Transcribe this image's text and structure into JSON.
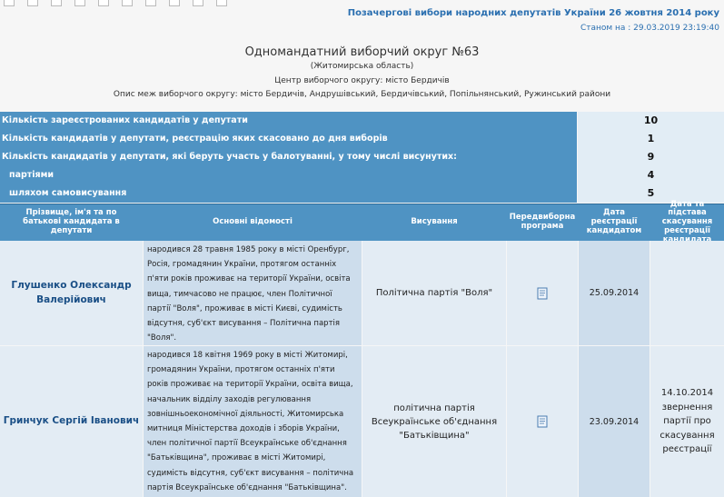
{
  "header": {
    "election_title": "Позачергові вибори народних депутатів України 26 жовтня 2014 року",
    "status": "Станом на : 29.03.2019 23:19:40"
  },
  "district": {
    "title": "Одномандатний виборчий округ №63",
    "region": "(Житомирська область)",
    "center": "Центр виборчого округу: місто Бердичів",
    "borders": "Опис меж виборчого округу: місто Бердичів, Андрушівський, Бердичівський, Попільнянський, Ружинський райони"
  },
  "stats": [
    {
      "label": "Кількість зареєстрованих кандидатів у депутати",
      "value": "10"
    },
    {
      "label": "Кількість кандидатів у депутати, реєстрацію яких скасовано до дня виборів",
      "value": "1"
    },
    {
      "label": "Кількість кандидатів у депутати, які беруть участь у балотуванні, у тому числі висунутих:",
      "value": "9"
    },
    {
      "label": "партіями",
      "value": "4"
    },
    {
      "label": "шляхом самовисування",
      "value": "5"
    }
  ],
  "table": {
    "headers": {
      "name": "Прізвище, ім'я та по батькові кандидата в депутати",
      "info": "Основні відомості",
      "nomination": "Висування",
      "program": "Передвиборна програма",
      "reg_date": "Дата реєстрації кандидатом",
      "cancel": "Дата та підстава скасування реєстрації кандидата"
    },
    "rows": [
      {
        "name": "Глушенко Олександр Валерійович",
        "info": "народився 28 травня 1985 року в місті Оренбург, Росія, громадянин України, протягом останніх п'яти років проживає на території України, освіта вища, тимчасово не працює, член Політичної партії \"Воля\", проживає в місті Києві, судимість відсутня, суб'єкт висування – Політична партія \"Воля\".",
        "nomination": "Політична партія \"Воля\"",
        "program_icon": "document-icon",
        "reg_date": "25.09.2014",
        "cancel": ""
      },
      {
        "name": "Гринчук Сергій Іванович",
        "info": "народився 18 квітня 1969 року в місті Житомирі, громадянин України, протягом останніх п'яти років проживає на території України, освіта вища, начальник відділу заходів регулювання зовнішньоекономічної діяльності, Житомирська митниця Міністерства доходів і зборів України, член політичної партії Всеукраїнське об'єднання \"Батьківщина\", проживає в місті Житомирі, судимість відсутня, суб'єкт висування – політична партія Всеукраїнське об'єднання \"Батьківщина\".",
        "nomination": "політична партія Всеукраїнське об'єднання \"Батьківщина\"",
        "program_icon": "document-icon",
        "reg_date": "23.09.2014",
        "cancel": "14.10.2014 звернення партії про скасування реєстрації"
      }
    ]
  }
}
